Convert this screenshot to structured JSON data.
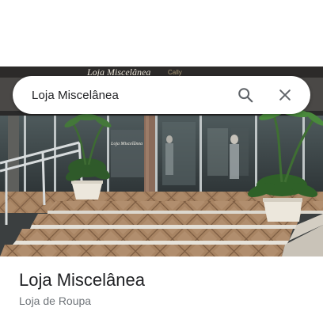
{
  "search": {
    "query": "Loja Miscelânea"
  },
  "photo": {
    "signage": "Loja Miscelânea",
    "door_sign": "Loja Miscelânea"
  },
  "place": {
    "name": "Loja Miscelânea",
    "category": "Loja de Roupa"
  },
  "icons": {
    "search": "search-icon",
    "close": "close-icon"
  },
  "colors": {
    "title_text": "#202124",
    "secondary_text": "#70757a",
    "icon": "#5f6368"
  }
}
